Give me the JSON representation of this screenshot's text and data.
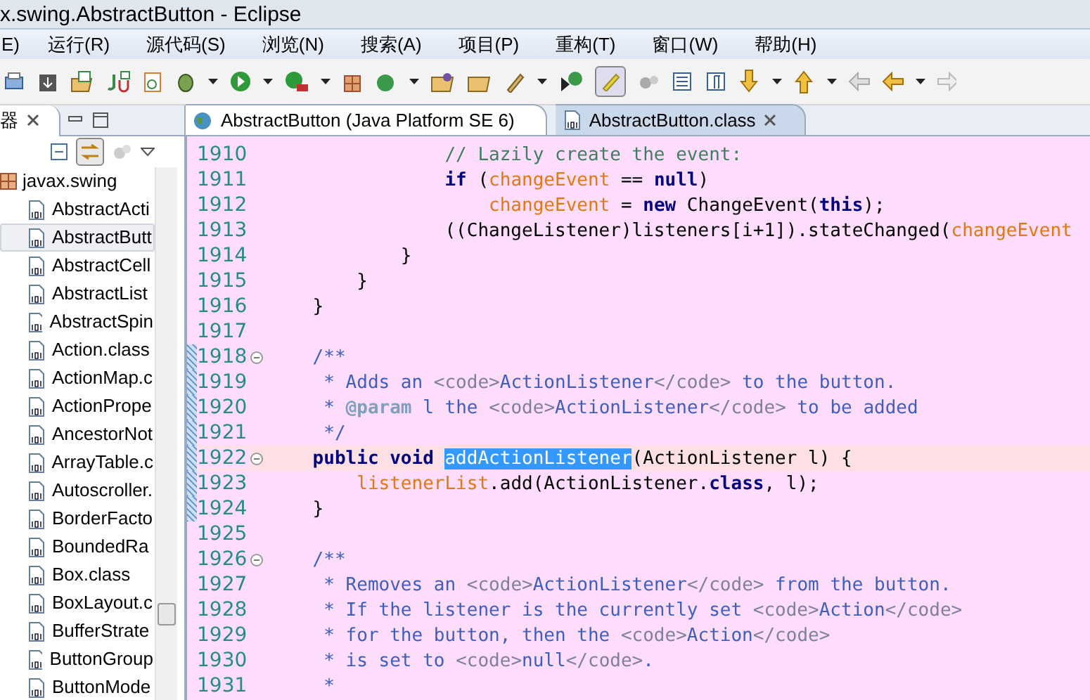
{
  "window": {
    "title": "x.swing.AbstractButton  -  Eclipse"
  },
  "menu": [
    "E)",
    "运行(R)",
    "源代码(S)",
    "浏览(N)",
    "搜索(A)",
    "项目(P)",
    "重构(T)",
    "窗口(W)",
    "帮助(H)"
  ],
  "left_panel": {
    "tab": {
      "label": "器"
    },
    "tree": {
      "label": "javax.swing",
      "children": [
        {
          "label": "AbstractActi",
          "selected": false
        },
        {
          "label": "AbstractButt",
          "selected": true
        },
        {
          "label": "AbstractCell",
          "selected": false
        },
        {
          "label": "AbstractList",
          "selected": false
        },
        {
          "label": "AbstractSpin",
          "selected": false
        },
        {
          "label": "Action.class",
          "selected": false
        },
        {
          "label": "ActionMap.c",
          "selected": false
        },
        {
          "label": "ActionPrope",
          "selected": false
        },
        {
          "label": "AncestorNot",
          "selected": false
        },
        {
          "label": "ArrayTable.c",
          "selected": false
        },
        {
          "label": "Autoscroller.",
          "selected": false
        },
        {
          "label": "BorderFacto",
          "selected": false
        },
        {
          "label": "BoundedRa",
          "selected": false
        },
        {
          "label": "Box.class",
          "selected": false
        },
        {
          "label": "BoxLayout.c",
          "selected": false
        },
        {
          "label": "BufferStrate",
          "selected": false
        },
        {
          "label": "ButtonGroup",
          "selected": false
        },
        {
          "label": "ButtonMode",
          "selected": false
        }
      ]
    }
  },
  "editor_tabs": [
    {
      "label": "AbstractButton (Java Platform SE 6)",
      "selected": false,
      "kind": "globe"
    },
    {
      "label": "AbstractButton.class",
      "selected": true,
      "kind": "class"
    }
  ],
  "code": [
    {
      "number": "1910",
      "tokens": [
        {
          "kind": "comment",
          "text": "                // Lazily create the event:"
        }
      ]
    },
    {
      "number": "1911",
      "tokens": [
        {
          "kind": "keyword",
          "text": "                if"
        },
        {
          "kind": "plain",
          "text": " ("
        },
        {
          "kind": "field",
          "text": "changeEvent"
        },
        {
          "kind": "plain",
          "text": " == "
        },
        {
          "kind": "keyword",
          "text": "null"
        },
        {
          "kind": "plain",
          "text": ")"
        }
      ]
    },
    {
      "number": "1912",
      "tokens": [
        {
          "kind": "field",
          "text": "                    changeEvent"
        },
        {
          "kind": "plain",
          "text": " = "
        },
        {
          "kind": "keyword",
          "text": "new"
        },
        {
          "kind": "plain",
          "text": " ChangeEvent("
        },
        {
          "kind": "keyword",
          "text": "this"
        },
        {
          "kind": "plain",
          "text": ");"
        }
      ]
    },
    {
      "number": "1913",
      "tokens": [
        {
          "kind": "plain",
          "text": "                ((ChangeListener)listeners[i+1]).stateChanged("
        },
        {
          "kind": "field",
          "text": "changeEvent"
        }
      ]
    },
    {
      "number": "1914",
      "tokens": [
        {
          "kind": "plain",
          "text": "            }"
        }
      ]
    },
    {
      "number": "1915",
      "tokens": [
        {
          "kind": "plain",
          "text": "        }"
        }
      ]
    },
    {
      "number": "1916",
      "tokens": [
        {
          "kind": "plain",
          "text": "    }"
        }
      ]
    },
    {
      "number": "1917"
    },
    {
      "number": "1918",
      "fold": true,
      "changed": true,
      "tokens": [
        {
          "kind": "doc",
          "text": "    /**"
        }
      ]
    },
    {
      "number": "1919",
      "changed": true,
      "tokens": [
        {
          "kind": "doc",
          "text": "     * Adds an "
        },
        {
          "kind": "tag",
          "text": "<code>"
        },
        {
          "kind": "doc",
          "text": "ActionListener"
        },
        {
          "kind": "tag",
          "text": "</code>"
        },
        {
          "kind": "doc",
          "text": " to the button."
        }
      ]
    },
    {
      "number": "1920",
      "changed": true,
      "tokens": [
        {
          "kind": "doc",
          "text": "     * "
        },
        {
          "kind": "annotation",
          "text": "@param"
        },
        {
          "kind": "doc",
          "text": " l the "
        },
        {
          "kind": "tag",
          "text": "<code>"
        },
        {
          "kind": "doc",
          "text": "ActionListener"
        },
        {
          "kind": "tag",
          "text": "</code>"
        },
        {
          "kind": "doc",
          "text": " to be added"
        }
      ]
    },
    {
      "number": "1921",
      "changed": true,
      "tokens": [
        {
          "kind": "doc",
          "text": "     */"
        }
      ]
    },
    {
      "number": "1922",
      "fold": true,
      "changed": true,
      "current": true,
      "tokens": [
        {
          "kind": "keyword",
          "text": "    public void "
        },
        {
          "kind": "selection",
          "text": "addActionListener"
        },
        {
          "kind": "plain",
          "text": "(ActionListener l) {"
        }
      ]
    },
    {
      "number": "1923",
      "changed": true,
      "tokens": [
        {
          "kind": "field",
          "text": "        listenerList"
        },
        {
          "kind": "plain",
          "text": ".add(ActionListener."
        },
        {
          "kind": "keyword",
          "text": "class"
        },
        {
          "kind": "plain",
          "text": ", l);"
        }
      ]
    },
    {
      "number": "1924",
      "changed": true,
      "tokens": [
        {
          "kind": "plain",
          "text": "    }"
        }
      ]
    },
    {
      "number": "1925"
    },
    {
      "number": "1926",
      "fold": true,
      "tokens": [
        {
          "kind": "doc",
          "text": "    /**"
        }
      ]
    },
    {
      "number": "1927",
      "tokens": [
        {
          "kind": "doc",
          "text": "     * Removes an "
        },
        {
          "kind": "tag",
          "text": "<code>"
        },
        {
          "kind": "doc",
          "text": "ActionListener"
        },
        {
          "kind": "tag",
          "text": "</code>"
        },
        {
          "kind": "doc",
          "text": " from the button."
        }
      ]
    },
    {
      "number": "1928",
      "tokens": [
        {
          "kind": "doc",
          "text": "     * If the listener is the currently set "
        },
        {
          "kind": "tag",
          "text": "<code>"
        },
        {
          "kind": "doc",
          "text": "Action"
        },
        {
          "kind": "tag",
          "text": "</code>"
        }
      ]
    },
    {
      "number": "1929",
      "tokens": [
        {
          "kind": "doc",
          "text": "     * for the button, then the "
        },
        {
          "kind": "tag",
          "text": "<code>"
        },
        {
          "kind": "doc",
          "text": "Action"
        },
        {
          "kind": "tag",
          "text": "</code>"
        }
      ]
    },
    {
      "number": "1930",
      "tokens": [
        {
          "kind": "doc",
          "text": "     * is set to "
        },
        {
          "kind": "tag",
          "text": "<code>"
        },
        {
          "kind": "doc",
          "text": "null"
        },
        {
          "kind": "tag",
          "text": "</code>"
        },
        {
          "kind": "doc",
          "text": "."
        }
      ]
    },
    {
      "number": "1931",
      "tokens": [
        {
          "kind": "doc",
          "text": "     *"
        }
      ]
    }
  ]
}
